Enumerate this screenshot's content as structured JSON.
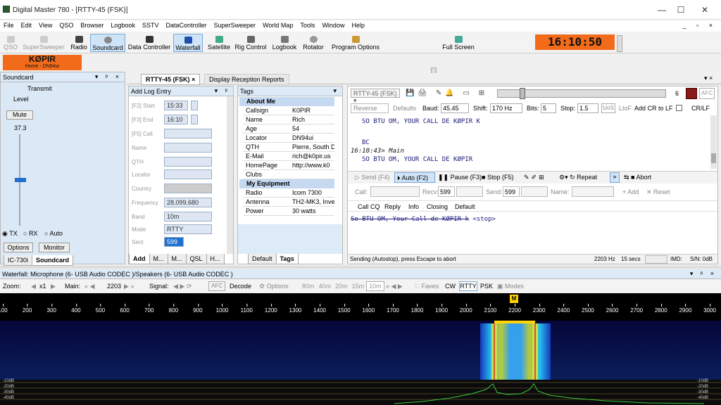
{
  "window": {
    "title": "Digital Master 780 - [RTTY-45 (FSK)]"
  },
  "menu": [
    "File",
    "Edit",
    "View",
    "QSO",
    "Browser",
    "Logbook",
    "SSTV",
    "DataController",
    "SuperSweeper",
    "World Map",
    "Tools",
    "Window",
    "Help"
  ],
  "toolbar": {
    "qso": "QSO",
    "supersweeper": "SuperSweeper",
    "radio": "Radio",
    "soundcard": "Soundcard",
    "data_controller": "Data Controller",
    "waterfall": "Waterfall",
    "satellite": "Satellite",
    "rig_control": "Rig Control",
    "logbook": "Logbook",
    "rotator": "Rotator",
    "program_options": "Program Options",
    "full_screen": "Full Screen"
  },
  "clock": "16:10:50",
  "callsign_box": {
    "call": "KØPIR",
    "home": "Home - DN94ui"
  },
  "soundcard_panel": {
    "title": "Soundcard",
    "transmit": "Transmit",
    "level": "Level",
    "mute": "Mute",
    "value": "37.3",
    "level_fraction": 0.5,
    "tx": "TX",
    "rx": "RX",
    "auto": "Auto",
    "options": "Options",
    "monitor": "Monitor",
    "tabs": [
      "IC-730i",
      "Soundcard"
    ]
  },
  "doc_tabs": [
    "RTTY-45 (FSK)",
    "Display Reception Reports"
  ],
  "log_entry": {
    "title": "Add Log Entry",
    "fields": [
      {
        "label": "[F2] Start",
        "value": "15:33"
      },
      {
        "label": "[F3] End",
        "value": "16:10"
      },
      {
        "label": "[F5] Call",
        "value": ""
      },
      {
        "label": "Name",
        "value": ""
      },
      {
        "label": "QTH",
        "value": ""
      },
      {
        "label": "Locator",
        "value": ""
      },
      {
        "label": "Country",
        "value": ""
      },
      {
        "label": "Frequency",
        "value": "28.099.680"
      },
      {
        "label": "Band",
        "value": "10m"
      },
      {
        "label": "Mode",
        "value": "RTTY"
      },
      {
        "label": "Sent",
        "value": "599"
      }
    ],
    "tabs": [
      "Add",
      "M...",
      "M...",
      "QSL",
      "H..."
    ]
  },
  "tags": {
    "title": "Tags",
    "about_me": "About Me",
    "rows": [
      {
        "k": "Callsign",
        "v": "K0PIR"
      },
      {
        "k": "Name",
        "v": "Rich"
      },
      {
        "k": "Age",
        "v": "54"
      },
      {
        "k": "Locator",
        "v": "DN94ui"
      },
      {
        "k": "QTH",
        "v": "Pierre, South D"
      },
      {
        "k": "E-Mail",
        "v": "rich@k0pir.us"
      },
      {
        "k": "HomePage",
        "v": "http://www.k0"
      },
      {
        "k": "Clubs",
        "v": ""
      }
    ],
    "my_equipment": "My Equipment",
    "equip": [
      {
        "k": "Radio",
        "v": "Icom 7300"
      },
      {
        "k": "Antenna",
        "v": "TH2-MK3, Inve"
      },
      {
        "k": "Power",
        "v": "30 watts"
      }
    ],
    "tabs": [
      "Default",
      "Tags"
    ]
  },
  "rtty": {
    "mode": "RTTY-45 (FSK)",
    "afc": "AFC",
    "channel": "6",
    "reverse": "Reverse",
    "defaults": "Defaults",
    "baud_label": "Baud:",
    "baud": "45.45",
    "shift_label": "Shift:",
    "shift": "170 Hz",
    "bits_label": "Bits:",
    "bits": "5",
    "stop_label": "Stop:",
    "stop": "1.5",
    "uos": "UoS",
    "ltof": "LtoF",
    "addcr": "Add CR to LF",
    "crlf": "CR/LF",
    "rx_lines": [
      "SO BTU OM, YOUR CALL DE KØPIR K",
      "",
      "BC",
      "SO BTU OM, YOUR CALL DE KØPIR"
    ],
    "stamp": "16:10:43> Main",
    "send": "Send (F4)",
    "auto": "Auto (F2)",
    "pause": "Pause (F3)",
    "stop_btn": "Stop (F5)",
    "repeat": "Repeat",
    "abort": "Abort",
    "call_lbl": "Call:",
    "recv_lbl": "Recv:",
    "recv": "599",
    "send_lbl": "Send:",
    "send_val": "599",
    "name_lbl": "Name:",
    "add": "Add",
    "reset": "Reset",
    "macros": [
      "Call CQ",
      "Reply",
      "Info",
      "Closing",
      "Default"
    ],
    "tx_text": "So BTU OM, Your Call de KØPIR k",
    "stop_tag": "<stop>",
    "status": "Sending (Autostop), press Escape to abort",
    "freq": "2203 Hz",
    "secs": "15 secs",
    "imd": "IMD:",
    "sn": "S/N: 0dB"
  },
  "waterfall": {
    "title": "Waterfall: Microphone (6- USB Audio CODEC )/Speakers (6- USB Audio CODEC )",
    "zoom": "Zoom:",
    "x1": "x1",
    "main": "Main:",
    "main_freq": "2203",
    "signal": "Signal:",
    "afc": "AFC",
    "decode": "Decode",
    "options": "Options",
    "bands": [
      "80m",
      "40m",
      "20m",
      "15m",
      "10m"
    ],
    "faves": "Faves",
    "modes": [
      "CW",
      "RTTY",
      "PSK"
    ],
    "modes_btn": "Modes",
    "marker": "M",
    "ticks": [
      "100",
      "200",
      "300",
      "400",
      "500",
      "600",
      "700",
      "800",
      "900",
      "1000",
      "1100",
      "1200",
      "1300",
      "1400",
      "1500",
      "1600",
      "1700",
      "1800",
      "1900",
      "2000",
      "2100",
      "2200",
      "2300",
      "2400",
      "2500",
      "2600",
      "2700",
      "2800",
      "2900",
      "3000"
    ],
    "db": [
      "-10dB",
      "-20dB",
      "-30dB",
      "-40dB"
    ]
  }
}
